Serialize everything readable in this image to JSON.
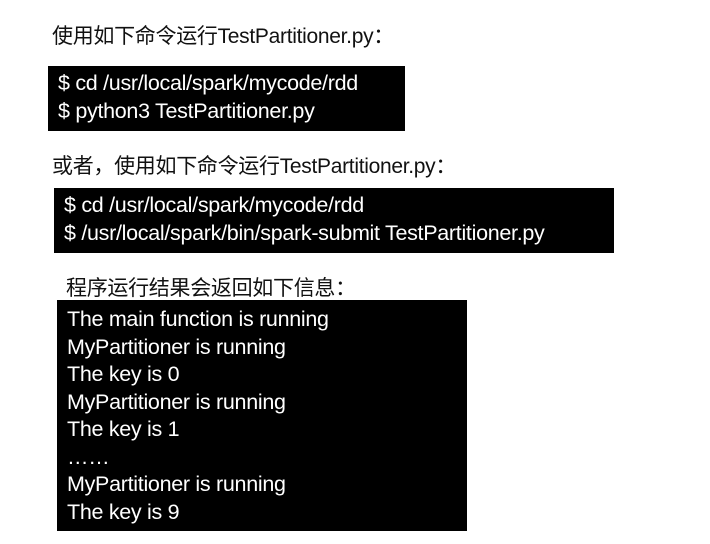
{
  "intro_1": "使用如下命令运行TestPartitioner.py：",
  "code_1": [
    "$ cd /usr/local/spark/mycode/rdd",
    "$ python3 TestPartitioner.py"
  ],
  "intro_2": "或者，使用如下命令运行TestPartitioner.py：",
  "code_2": [
    "$ cd /usr/local/spark/mycode/rdd",
    "$ /usr/local/spark/bin/spark-submit TestPartitioner.py"
  ],
  "intro_3": "程序运行结果会返回如下信息：",
  "output": [
    "The main function is running",
    "MyPartitioner is running",
    "The key is 0",
    "MyPartitioner is running",
    "The key is 1",
    "……",
    "MyPartitioner is running",
    "The key is 9"
  ]
}
